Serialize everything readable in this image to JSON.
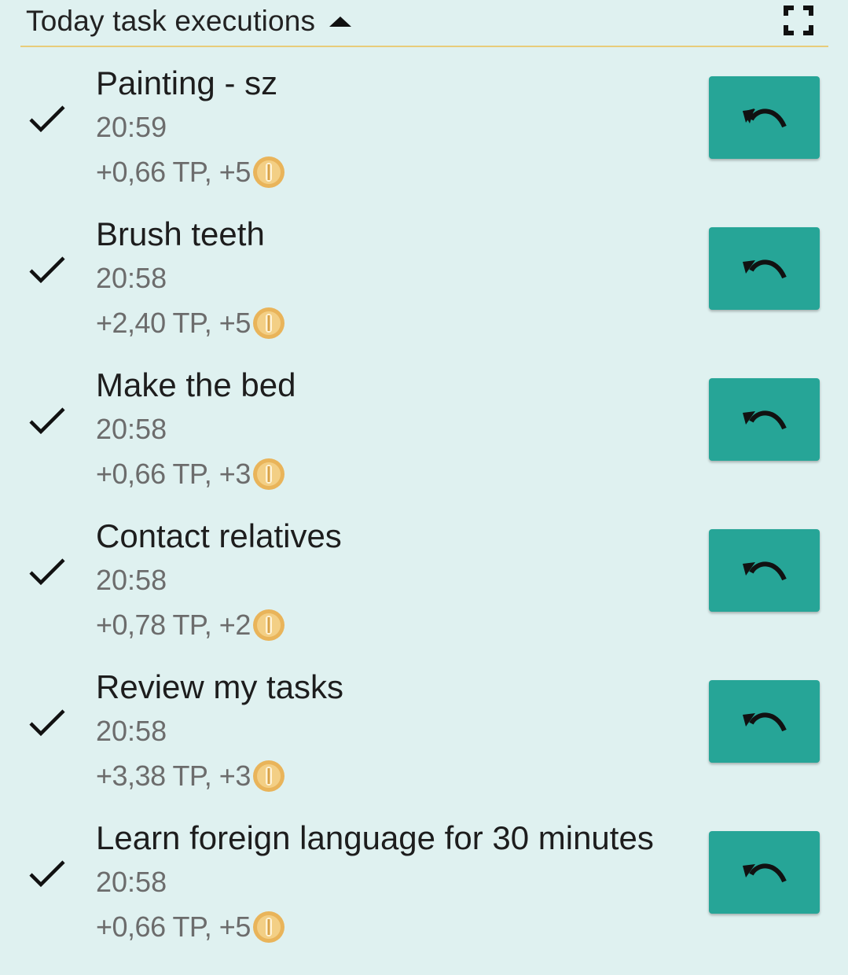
{
  "header": {
    "title": "Today task executions",
    "collapse_icon": "arrow-up-icon",
    "fullscreen_icon": "fullscreen-icon",
    "divider_color": "#e8cc7a"
  },
  "colors": {
    "background": "#dff1f0",
    "undo_button": "#26a597",
    "coin": "#e9b45a"
  },
  "tasks": [
    {
      "name": "Painting - sz",
      "time": "20:59",
      "reward": "+0,66 TP, +5"
    },
    {
      "name": "Brush teeth",
      "time": "20:58",
      "reward": "+2,40 TP, +5"
    },
    {
      "name": "Make the bed",
      "time": "20:58",
      "reward": "+0,66 TP, +3"
    },
    {
      "name": "Contact relatives",
      "time": "20:58",
      "reward": "+0,78 TP, +2"
    },
    {
      "name": "Review my tasks",
      "time": "20:58",
      "reward": "+3,38 TP, +3"
    },
    {
      "name": "Learn foreign language for 30 minutes",
      "time": "20:58",
      "reward": "+0,66 TP, +5"
    }
  ],
  "icons": {
    "check": "check-icon",
    "undo": "undo-icon",
    "coin": "coin-icon"
  }
}
